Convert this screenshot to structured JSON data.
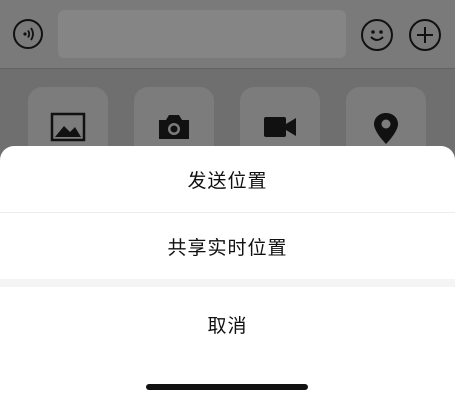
{
  "input_bar": {
    "voice_icon": "voice-wave-icon",
    "emoji_icon": "smiley-icon",
    "plus_icon": "plus-icon"
  },
  "panel_tiles": [
    {
      "icon": "image-icon"
    },
    {
      "icon": "camera-icon"
    },
    {
      "icon": "video-icon"
    },
    {
      "icon": "location-pin-icon"
    }
  ],
  "action_sheet": {
    "send_location": "发送位置",
    "share_live_location": "共享实时位置",
    "cancel": "取消"
  },
  "colors": {
    "overlay": "#6f6f6f",
    "sheet_bg": "#ffffff",
    "separator_gap": "#f4f4f4"
  }
}
